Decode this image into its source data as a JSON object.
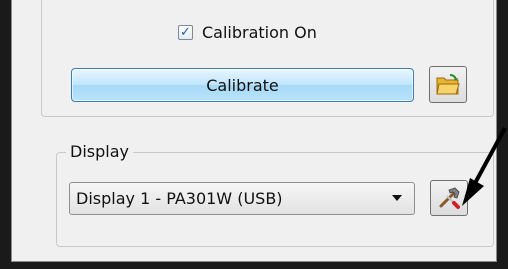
{
  "calibration": {
    "checkbox_label": "Calibration On",
    "checked": true,
    "calibrate_button_label": "Calibrate",
    "folder_icon": "folder-open-icon"
  },
  "display_group": {
    "label": "Display",
    "selected_display": "Display 1 - PA301W (USB)",
    "tools_icon": "hammer-screwdriver-icon"
  },
  "annotation": {
    "arrow_color": "#000000"
  },
  "colors": {
    "window_bg": "#f0f0f0",
    "button_accent": "#bee6fd",
    "button_border": "#3c7fb1"
  }
}
